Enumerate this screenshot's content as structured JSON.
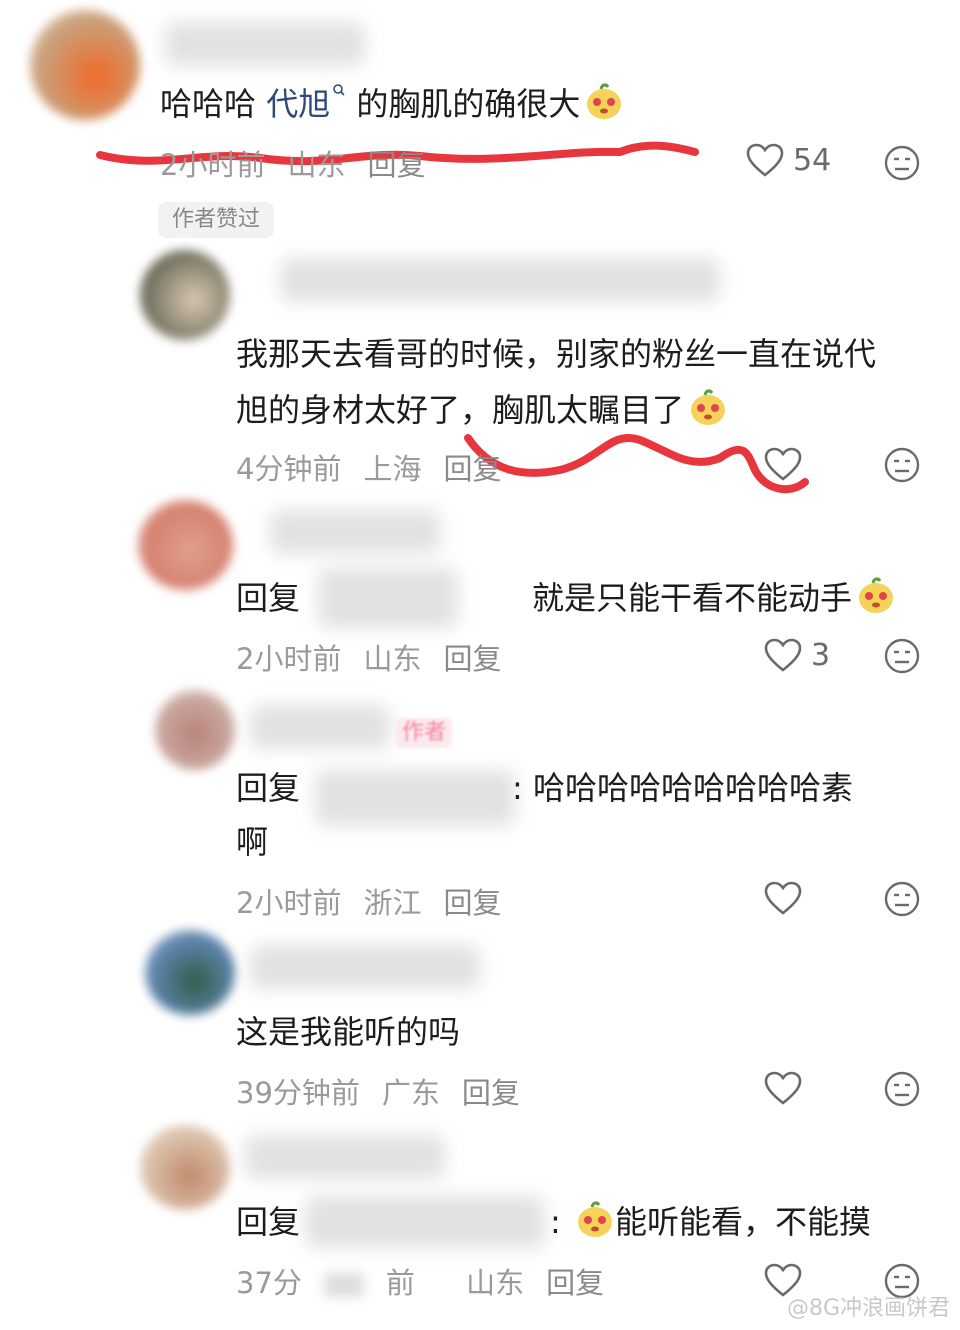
{
  "comments": [
    {
      "text_before": "哈哈哈 ",
      "mention": "代旭",
      "mention_icon": "search-icon",
      "text_after": " 的胸肌的确很大",
      "emoji": "bean-mascot-emoji",
      "time": "2小时前",
      "location": "山东",
      "reply_label": "回复",
      "likes": "54",
      "badge": "作者赞过"
    },
    {
      "line1": "我那天去看哥的时候，别家的粉丝一直在说代",
      "line2": "旭的身材太好了，胸肌太瞩目了",
      "emoji": "bean-mascot-emoji",
      "time": "4分钟前",
      "location": "上海",
      "reply_label": "回复",
      "likes": ""
    },
    {
      "prefix": "回复",
      "text": "就是只能干看不能动手",
      "emoji": "bean-mascot-emoji",
      "time": "2小时前",
      "location": "山东",
      "reply_label": "回复",
      "likes": "3"
    },
    {
      "author_tag": "作者",
      "prefix": "回复",
      "line1": ": 哈哈哈哈哈哈哈哈哈素",
      "line2": "啊",
      "time": "2小时前",
      "location": "浙江",
      "reply_label": "回复",
      "likes": ""
    },
    {
      "text": "这是我能听的吗",
      "time": "39分钟前",
      "location": "广东",
      "reply_label": "回复",
      "likes": ""
    },
    {
      "prefix": "回复",
      "colon": ":",
      "text": "能听能看，不能摸",
      "emoji": "bean-mascot-emoji",
      "time": "37分",
      "time2": "前",
      "location": "山东",
      "reply_label": "回复",
      "likes": ""
    }
  ],
  "watermark": "@8G冲浪画饼君",
  "colors": {
    "annotation_red": "#e8363f",
    "meta_gray": "#9a9a9a",
    "mention_blue": "#2f4a7a"
  }
}
